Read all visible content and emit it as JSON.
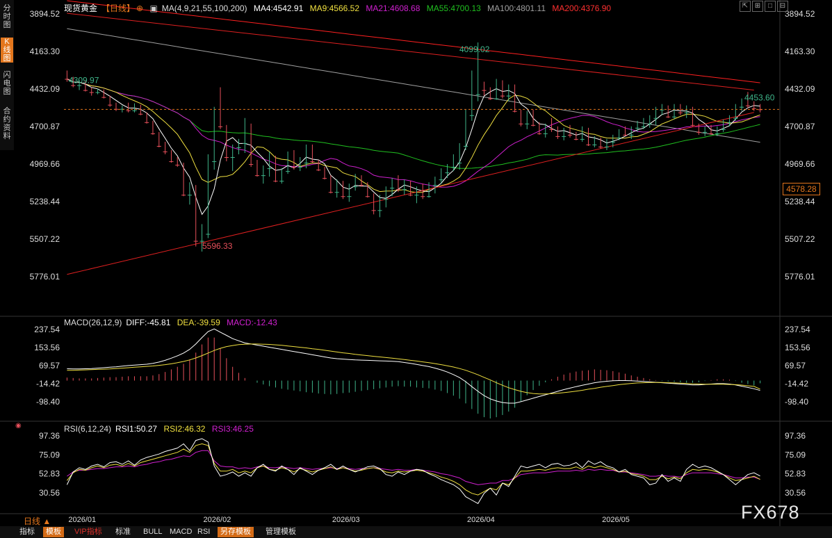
{
  "sidebar": {
    "tabs": [
      "分时图",
      "K线图",
      "闪电图",
      "合约资料"
    ]
  },
  "header": {
    "instrument": "现货黄金",
    "period": "【日线】",
    "ma_params": "MA(4,9,21,55,100,200)",
    "ma_labels": [
      "MA4:4542.91",
      "MA9:4566.52",
      "MA21:4608.68",
      "MA55:4700.13",
      "MA100:4801.11",
      "MA200:4376.90"
    ]
  },
  "macd_legend": {
    "params": "MACD(26,12,9)",
    "diff": "DIFF:-45.81",
    "dea": "DEA:-39.59",
    "macd": "MACD:-12.43"
  },
  "rsi_legend": {
    "params": "RSI(6,12,24)",
    "rsi1": "RSI1:50.27",
    "rsi2": "RSI2:46.32",
    "rsi3": "RSI3:46.25"
  },
  "annotations": {
    "high": "5596.33",
    "low": "4099.02",
    "start": "4309.97",
    "recent_low": "4453.60",
    "last_price": "4578.28"
  },
  "period_selector": "日线 ▲",
  "bottom_tabs": [
    "指标",
    "模板",
    "VIP指标",
    "标准",
    "BULL",
    "MACD",
    "RSI",
    "另存模板",
    "管理模板"
  ],
  "watermark": "FX678",
  "colors": {
    "up": "#e8505b",
    "down": "#3fb58a",
    "ma4": "#ffffff",
    "ma9": "#f0e040",
    "ma21": "#d020d0",
    "ma55": "#20c020",
    "ma100": "#a0a0a0",
    "ma200": "#ff2020",
    "accent": "#e4761c"
  },
  "chart_data": [
    {
      "type": "candlestick",
      "title": "现货黄金【日线】",
      "x_labels": [
        "2026/01",
        "2026/02",
        "2026/03",
        "2026/04",
        "2026/05"
      ],
      "y_ticks": [
        "5776.01",
        "5507.22",
        "5238.44",
        "4969.66",
        "4700.87",
        "4432.09",
        "4163.30",
        "3894.52"
      ],
      "ylim": [
        3894.52,
        5776.01
      ],
      "ohlc": [
        [
          4309.97,
          4380,
          4300,
          4360
        ],
        [
          4360,
          4420,
          4345,
          4405
        ],
        [
          4405,
          4440,
          4370,
          4385
        ],
        [
          4385,
          4450,
          4375,
          4440
        ],
        [
          4440,
          4480,
          4420,
          4455
        ],
        [
          4455,
          4470,
          4430,
          4445
        ],
        [
          4445,
          4500,
          4435,
          4490
        ],
        [
          4490,
          4560,
          4480,
          4545
        ],
        [
          4545,
          4590,
          4530,
          4575
        ],
        [
          4575,
          4600,
          4550,
          4565
        ],
        [
          4565,
          4600,
          4530,
          4585
        ],
        [
          4585,
          4600,
          4535,
          4550
        ],
        [
          4550,
          4620,
          4545,
          4610
        ],
        [
          4610,
          4680,
          4600,
          4670
        ],
        [
          4670,
          4760,
          4660,
          4750
        ],
        [
          4750,
          4850,
          4740,
          4840
        ],
        [
          4840,
          4900,
          4810,
          4880
        ],
        [
          4880,
          4960,
          4870,
          4950
        ],
        [
          4950,
          4990,
          4920,
          4975
        ],
        [
          4975,
          5200,
          4960,
          5190
        ],
        [
          5190,
          5260,
          5100,
          5140
        ],
        [
          5140,
          5560,
          5120,
          5520
        ],
        [
          5520,
          5596.33,
          5400,
          5470
        ],
        [
          5470,
          5500,
          4900,
          4950
        ],
        [
          4950,
          5010,
          4560,
          4650
        ],
        [
          4650,
          4720,
          4420,
          4700
        ],
        [
          4700,
          4950,
          4690,
          4920
        ],
        [
          4920,
          5020,
          4830,
          4850
        ],
        [
          4850,
          4900,
          4790,
          4820
        ],
        [
          4820,
          4890,
          4640,
          4700
        ],
        [
          4700,
          4990,
          4680,
          4970
        ],
        [
          4970,
          5060,
          4940,
          5050
        ],
        [
          5050,
          5110,
          4980,
          5000
        ],
        [
          5000,
          5060,
          4880,
          4920
        ],
        [
          4920,
          5100,
          4910,
          5090
        ],
        [
          5090,
          5110,
          5000,
          5020
        ],
        [
          5020,
          5040,
          4880,
          4890
        ],
        [
          4890,
          5010,
          4870,
          4990
        ],
        [
          4990,
          5020,
          4920,
          4960
        ],
        [
          4960,
          5000,
          4830,
          4840
        ],
        [
          4840,
          4960,
          4830,
          4950
        ],
        [
          4950,
          5020,
          4940,
          5010
        ],
        [
          5010,
          5080,
          4990,
          5070
        ],
        [
          5070,
          5180,
          5050,
          5170
        ],
        [
          5170,
          5210,
          5080,
          5100
        ],
        [
          5100,
          5220,
          5090,
          5200
        ],
        [
          5200,
          5240,
          5110,
          5130
        ],
        [
          5130,
          5160,
          5040,
          5060
        ],
        [
          5060,
          5130,
          5050,
          5120
        ],
        [
          5120,
          5210,
          5100,
          5200
        ],
        [
          5200,
          5330,
          5180,
          5300
        ],
        [
          5300,
          5350,
          5190,
          5220
        ],
        [
          5220,
          5280,
          5130,
          5140
        ],
        [
          5140,
          5200,
          5070,
          5090
        ],
        [
          5090,
          5170,
          5050,
          5150
        ],
        [
          5150,
          5190,
          5080,
          5100
        ],
        [
          5100,
          5200,
          5090,
          5190
        ],
        [
          5190,
          5250,
          5130,
          5160
        ],
        [
          5160,
          5220,
          5110,
          5200
        ],
        [
          5200,
          5210,
          5100,
          5120
        ],
        [
          5120,
          5180,
          5060,
          5080
        ],
        [
          5080,
          5110,
          5000,
          5030
        ],
        [
          5030,
          5070,
          4970,
          4990
        ],
        [
          4990,
          5020,
          4900,
          4960
        ],
        [
          4960,
          5010,
          4820,
          4840
        ],
        [
          4840,
          4870,
          4580,
          4620
        ],
        [
          4620,
          4660,
          4300,
          4470
        ],
        [
          4470,
          4520,
          4099.02,
          4400
        ],
        [
          4400,
          4480,
          4380,
          4440
        ],
        [
          4440,
          4510,
          4420,
          4500
        ],
        [
          4500,
          4510,
          4360,
          4380
        ],
        [
          4380,
          4500,
          4370,
          4480
        ],
        [
          4480,
          4520,
          4400,
          4410
        ],
        [
          4410,
          4600,
          4400,
          4590
        ],
        [
          4590,
          4700,
          4580,
          4680
        ],
        [
          4680,
          4720,
          4590,
          4610
        ],
        [
          4610,
          4700,
          4580,
          4690
        ],
        [
          4690,
          4760,
          4670,
          4750
        ],
        [
          4750,
          4780,
          4680,
          4700
        ],
        [
          4700,
          4740,
          4640,
          4720
        ],
        [
          4720,
          4790,
          4700,
          4770
        ],
        [
          4770,
          4800,
          4710,
          4730
        ],
        [
          4730,
          4780,
          4690,
          4760
        ],
        [
          4760,
          4800,
          4740,
          4790
        ],
        [
          4790,
          4810,
          4700,
          4720
        ],
        [
          4720,
          4840,
          4710,
          4830
        ],
        [
          4830,
          4850,
          4770,
          4790
        ],
        [
          4790,
          4860,
          4780,
          4845
        ],
        [
          4845,
          4870,
          4790,
          4810
        ],
        [
          4810,
          4850,
          4760,
          4780
        ],
        [
          4780,
          4800,
          4720,
          4730
        ],
        [
          4730,
          4770,
          4700,
          4760
        ],
        [
          4760,
          4790,
          4700,
          4710
        ],
        [
          4710,
          4740,
          4660,
          4700
        ],
        [
          4700,
          4720,
          4640,
          4680
        ],
        [
          4680,
          4710,
          4620,
          4640
        ],
        [
          4640,
          4690,
          4560,
          4580
        ],
        [
          4580,
          4620,
          4540,
          4560
        ],
        [
          4560,
          4640,
          4550,
          4630
        ],
        [
          4630,
          4650,
          4540,
          4560
        ],
        [
          4560,
          4620,
          4540,
          4600
        ],
        [
          4600,
          4640,
          4550,
          4570
        ],
        [
          4570,
          4700,
          4560,
          4690
        ],
        [
          4690,
          4760,
          4680,
          4740
        ],
        [
          4740,
          4770,
          4700,
          4720
        ],
        [
          4720,
          4760,
          4690,
          4750
        ],
        [
          4750,
          4770,
          4700,
          4720
        ],
        [
          4720,
          4740,
          4650,
          4670
        ],
        [
          4670,
          4700,
          4620,
          4640
        ],
        [
          4640,
          4660,
          4540,
          4560
        ],
        [
          4560,
          4590,
          4500,
          4520
        ],
        [
          4520,
          4570,
          4453.6,
          4550
        ],
        [
          4550,
          4590,
          4520,
          4570
        ],
        [
          4570,
          4600,
          4540,
          4578.28
        ]
      ],
      "trendlines": [
        {
          "from": [
            1,
            5760
          ],
          "to": [
            113,
            4600
          ]
        },
        {
          "from": [
            1,
            3890
          ],
          "to": [
            113,
            4440
          ]
        }
      ]
    },
    {
      "type": "macd",
      "title": "MACD(26,12,9)",
      "y_ticks": [
        "237.54",
        "153.56",
        "69.57",
        "-14.42",
        "-98.40"
      ],
      "ylim": [
        -130,
        250
      ],
      "diff": [
        55,
        54,
        54,
        55,
        56,
        58,
        60,
        62,
        64,
        67,
        70,
        72,
        74,
        76,
        80,
        86,
        94,
        104,
        115,
        128,
        145,
        170,
        200,
        228,
        240,
        225,
        210,
        195,
        185,
        175,
        170,
        165,
        160,
        155,
        150,
        145,
        140,
        135,
        130,
        125,
        120,
        115,
        110,
        105,
        102,
        100,
        98,
        96,
        95,
        94,
        93,
        92,
        91,
        90,
        88,
        84,
        80,
        75,
        70,
        65,
        58,
        50,
        40,
        28,
        14,
        -5,
        -28,
        -50,
        -70,
        -85,
        -95,
        -102,
        -105,
        -105,
        -98,
        -90,
        -82,
        -74,
        -66,
        -58,
        -50,
        -42,
        -35,
        -28,
        -22,
        -16,
        -10,
        -6,
        -3,
        -1,
        0,
        0,
        -1,
        -2,
        -4,
        -6,
        -8,
        -10,
        -12,
        -14,
        -16,
        -18,
        -20,
        -20,
        -18,
        -16,
        -14,
        -14,
        -16,
        -20,
        -26,
        -32,
        -38,
        -45.81
      ],
      "dea": [
        48,
        48,
        49,
        50,
        51,
        52,
        53,
        54,
        56,
        58,
        60,
        62,
        64,
        66,
        68,
        71,
        74,
        78,
        83,
        89,
        96,
        105,
        116,
        128,
        140,
        150,
        158,
        163,
        167,
        169,
        170,
        170,
        169,
        168,
        166,
        164,
        161,
        158,
        155,
        152,
        148,
        145,
        141,
        137,
        133,
        129,
        126,
        122,
        119,
        116,
        113,
        110,
        107,
        104,
        101,
        98,
        94,
        91,
        87,
        83,
        79,
        74,
        69,
        63,
        56,
        48,
        38,
        27,
        15,
        3,
        -10,
        -22,
        -33,
        -42,
        -50,
        -56,
        -60,
        -62,
        -62,
        -61,
        -59,
        -56,
        -53,
        -49,
        -45,
        -40,
        -36,
        -31,
        -27,
        -23,
        -19,
        -16,
        -13,
        -11,
        -10,
        -9,
        -9,
        -9,
        -10,
        -11,
        -12,
        -13,
        -15,
        -16,
        -17,
        -17,
        -17,
        -17,
        -18,
        -19,
        -21,
        -24,
        -27,
        -39.59
      ]
    },
    {
      "type": "rsi",
      "title": "RSI(6,12,24)",
      "y_ticks": [
        "97.36",
        "75.09",
        "52.83",
        "30.56"
      ],
      "ylim": [
        20,
        100
      ],
      "rsi1": [
        40,
        55,
        60,
        58,
        62,
        64,
        61,
        66,
        67,
        64,
        68,
        63,
        69,
        72,
        74,
        76,
        79,
        81,
        83,
        88,
        80,
        92,
        94,
        90,
        62,
        50,
        52,
        55,
        50,
        54,
        50,
        60,
        64,
        58,
        56,
        62,
        58,
        52,
        60,
        56,
        52,
        57,
        60,
        64,
        58,
        62,
        58,
        55,
        58,
        61,
        62,
        59,
        52,
        50,
        55,
        52,
        56,
        58,
        57,
        53,
        50,
        46,
        43,
        40,
        35,
        26,
        22,
        18,
        30,
        36,
        28,
        42,
        38,
        50,
        62,
        60,
        62,
        64,
        60,
        64,
        65,
        62,
        63,
        66,
        60,
        68,
        64,
        67,
        62,
        60,
        55,
        58,
        52,
        50,
        48,
        40,
        42,
        52,
        44,
        48,
        44,
        58,
        64,
        60,
        62,
        60,
        56,
        52,
        46,
        40,
        46,
        52,
        54,
        50.27
      ],
      "rsi2": [
        45,
        54,
        58,
        57,
        60,
        62,
        60,
        63,
        64,
        62,
        65,
        62,
        66,
        68,
        70,
        72,
        74,
        76,
        78,
        82,
        78,
        86,
        88,
        86,
        65,
        56,
        56,
        58,
        54,
        56,
        54,
        60,
        62,
        58,
        57,
        60,
        58,
        55,
        59,
        57,
        55,
        57,
        59,
        61,
        58,
        60,
        58,
        56,
        57,
        59,
        60,
        58,
        55,
        54,
        56,
        55,
        56,
        57,
        56,
        54,
        52,
        49,
        47,
        44,
        40,
        34,
        30,
        28,
        32,
        36,
        34,
        42,
        40,
        48,
        56,
        56,
        57,
        58,
        57,
        59,
        60,
        59,
        59,
        61,
        58,
        62,
        60,
        62,
        60,
        58,
        55,
        56,
        53,
        52,
        50,
        46,
        46,
        50,
        47,
        49,
        47,
        54,
        58,
        57,
        58,
        57,
        55,
        52,
        48,
        45,
        46,
        48,
        50,
        46.32
      ],
      "rsi3": [
        50,
        55,
        57,
        57,
        58,
        59,
        59,
        60,
        61,
        61,
        62,
        61,
        63,
        64,
        66,
        67,
        69,
        70,
        72,
        74,
        73,
        78,
        80,
        80,
        68,
        62,
        61,
        61,
        59,
        60,
        59,
        61,
        62,
        60,
        60,
        61,
        60,
        59,
        60,
        59,
        58,
        59,
        59,
        60,
        59,
        60,
        59,
        58,
        59,
        59,
        60,
        59,
        58,
        57,
        58,
        57,
        57,
        58,
        57,
        56,
        55,
        53,
        52,
        50,
        48,
        44,
        42,
        40,
        41,
        42,
        42,
        45,
        45,
        48,
        52,
        53,
        54,
        54,
        54,
        55,
        56,
        56,
        56,
        57,
        56,
        58,
        57,
        58,
        57,
        57,
        55,
        55,
        54,
        53,
        52,
        50,
        50,
        51,
        50,
        50,
        49,
        52,
        54,
        54,
        54,
        54,
        53,
        52,
        50,
        48,
        48,
        49,
        49,
        46.25
      ]
    }
  ]
}
